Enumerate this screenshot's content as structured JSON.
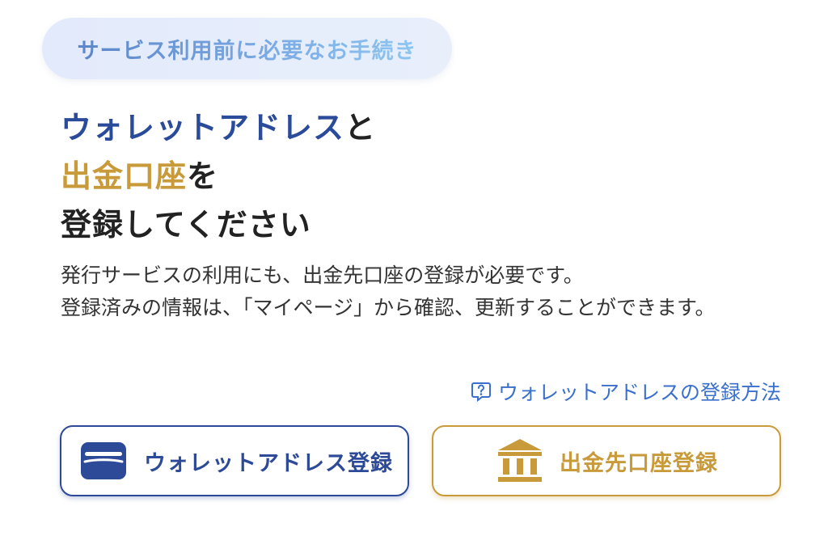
{
  "badge": {
    "text": "サービス利用前に必要なお手続き"
  },
  "headline": {
    "line1_highlight": "ウォレットアドレス",
    "line1_rest": "と",
    "line2_highlight": "出金口座",
    "line2_rest": "を",
    "line3": "登録してください"
  },
  "description": {
    "line1": "発行サービスの利用にも、出金先口座の登録が必要です。",
    "line2": "登録済みの情報は、「マイページ」から確認、更新することができます。"
  },
  "help_link": {
    "label": "ウォレットアドレスの登録方法",
    "icon": "question-bubble-icon"
  },
  "buttons": {
    "wallet": {
      "label": "ウォレットアドレス登録",
      "icon": "wallet-icon"
    },
    "bank": {
      "label": "出金先口座登録",
      "icon": "bank-icon"
    }
  },
  "colors": {
    "primary_blue": "#2a4a9a",
    "accent_gold": "#c89a3a",
    "link_blue": "#3a6fcb",
    "badge_background": "#e3eafb"
  }
}
